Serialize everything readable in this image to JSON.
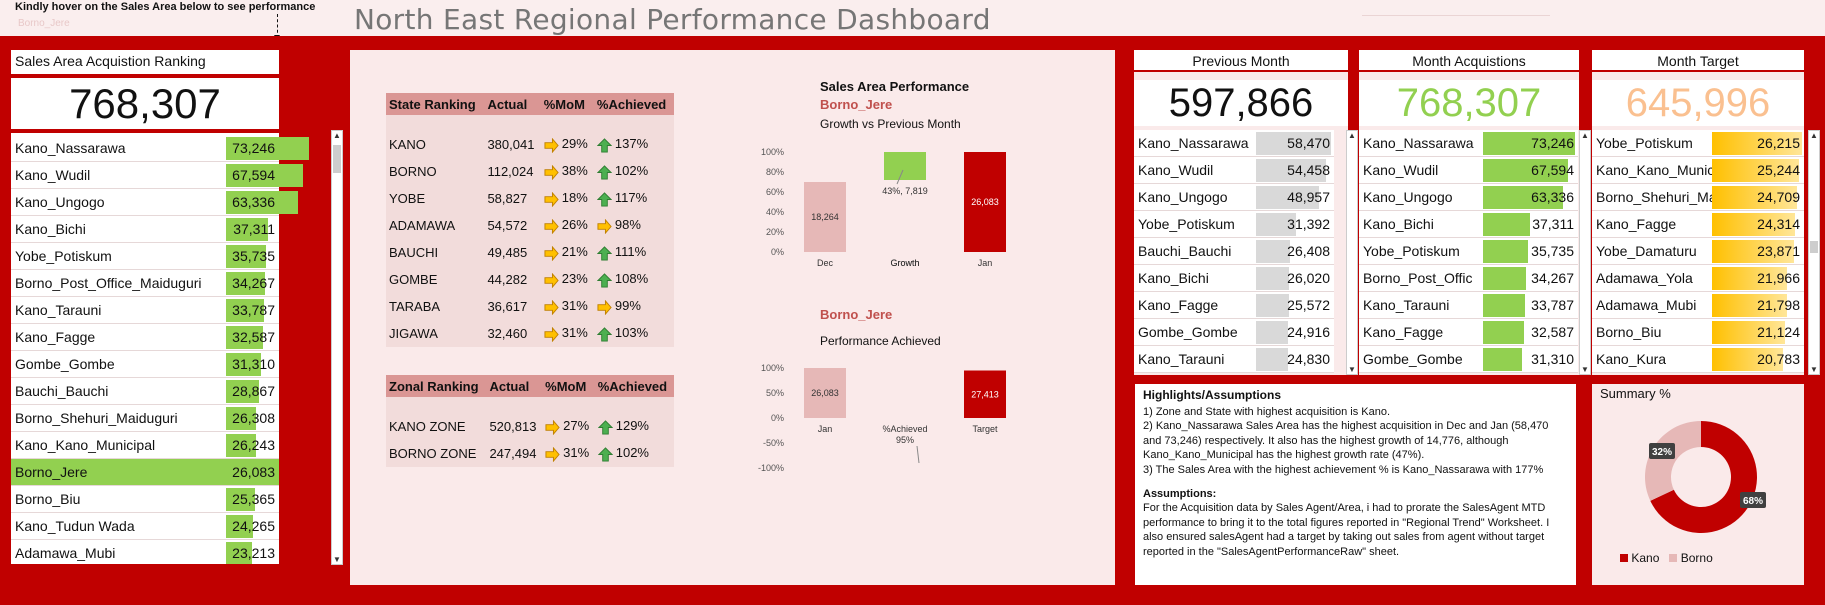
{
  "header": {
    "hint": "Kindly hover on the Sales Area below to see performance",
    "hint_sub": "Borno_Jere",
    "title": "North East Regional Performance Dashboard"
  },
  "ranking": {
    "title": "Sales Area Acquistion Ranking",
    "total": "768,307",
    "max": 73246,
    "items": [
      {
        "name": "Kano_Nassarawa",
        "value": "73,246",
        "n": 73246
      },
      {
        "name": "Kano_Wudil",
        "value": "67,594",
        "n": 67594
      },
      {
        "name": "Kano_Ungogo",
        "value": "63,336",
        "n": 63336
      },
      {
        "name": "Kano_Bichi",
        "value": "37,311",
        "n": 37311
      },
      {
        "name": "Yobe_Potiskum",
        "value": "35,735",
        "n": 35735
      },
      {
        "name": "Borno_Post_Office_Maiduguri",
        "value": "34,267",
        "n": 34267
      },
      {
        "name": "Kano_Tarauni",
        "value": "33,787",
        "n": 33787
      },
      {
        "name": "Kano_Fagge",
        "value": "32,587",
        "n": 32587
      },
      {
        "name": "Gombe_Gombe",
        "value": "31,310",
        "n": 31310
      },
      {
        "name": "Bauchi_Bauchi",
        "value": "28,867",
        "n": 28867
      },
      {
        "name": "Borno_Shehuri_Maiduguri",
        "value": "26,308",
        "n": 26308
      },
      {
        "name": "Kano_Kano_Municipal",
        "value": "26,243",
        "n": 26243
      },
      {
        "name": "Borno_Jere",
        "value": "26,083",
        "n": 26083,
        "selected": true
      },
      {
        "name": "Borno_Biu",
        "value": "25,365",
        "n": 25365
      },
      {
        "name": "Kano_Tudun Wada",
        "value": "24,265",
        "n": 24265
      },
      {
        "name": "Adamawa_Mubi",
        "value": "23,213",
        "n": 23213
      }
    ]
  },
  "state_table": {
    "headers": [
      "State Ranking",
      "Actual",
      "%MoM",
      "%Achieved"
    ],
    "rows": [
      {
        "name": "KANO",
        "actual": "380,041",
        "mom": "29%",
        "ach": "137%",
        "up": true
      },
      {
        "name": "BORNO",
        "actual": "112,024",
        "mom": "38%",
        "ach": "102%",
        "up": true
      },
      {
        "name": "YOBE",
        "actual": "58,827",
        "mom": "18%",
        "ach": "117%",
        "up": true
      },
      {
        "name": "ADAMAWA",
        "actual": "54,572",
        "mom": "26%",
        "ach": "98%",
        "up": false
      },
      {
        "name": "BAUCHI",
        "actual": "49,485",
        "mom": "21%",
        "ach": "111%",
        "up": true
      },
      {
        "name": "GOMBE",
        "actual": "44,282",
        "mom": "23%",
        "ach": "108%",
        "up": true
      },
      {
        "name": "TARABA",
        "actual": "36,617",
        "mom": "31%",
        "ach": "99%",
        "up": false
      },
      {
        "name": "JIGAWA",
        "actual": "32,460",
        "mom": "31%",
        "ach": "103%",
        "up": true
      }
    ]
  },
  "zonal_table": {
    "headers": [
      "Zonal Ranking",
      "Actual",
      "%MoM",
      "%Achieved"
    ],
    "rows": [
      {
        "name": "KANO ZONE",
        "actual": "520,813",
        "mom": "27%",
        "ach": "129%",
        "up": true
      },
      {
        "name": "BORNO ZONE",
        "actual": "247,494",
        "mom": "31%",
        "ach": "102%",
        "up": true
      }
    ]
  },
  "chart_data": [
    {
      "type": "bar",
      "title": "Sales Area Performance",
      "subtitle_area": "Borno_Jere",
      "subtitle": "Growth vs Previous Month",
      "categories": [
        "Dec",
        "Growth",
        "Jan"
      ],
      "values": [
        18264,
        7819,
        26083
      ],
      "labels": [
        "18,264",
        "43%,  7,819",
        "26,083"
      ],
      "ylim": [
        0,
        100
      ],
      "yticks": [
        "100%",
        "80%",
        "60%",
        "40%",
        "20%",
        "0%"
      ],
      "percent": [
        70,
        28,
        100
      ]
    },
    {
      "type": "bar",
      "title": "Borno_Jere",
      "subtitle": "Performance Achieved",
      "categories": [
        "Jan",
        "%Achieved",
        "Target"
      ],
      "values": [
        26083,
        95,
        27413
      ],
      "labels": [
        "26,083",
        "%Achieved\n95%",
        "27,413"
      ],
      "ylim": [
        -100,
        100
      ],
      "yticks": [
        "100%",
        "50%",
        "0%",
        "-50%",
        "-100%"
      ],
      "percent": [
        100,
        0,
        95
      ]
    }
  ],
  "prev": {
    "title": "Previous Month",
    "total": "597,866",
    "max": 58470,
    "items": [
      {
        "name": "Kano_Nassarawa",
        "value": "58,470",
        "n": 58470
      },
      {
        "name": "Kano_Wudil",
        "value": "54,458",
        "n": 54458
      },
      {
        "name": "Kano_Ungogo",
        "value": "48,957",
        "n": 48957
      },
      {
        "name": "Yobe_Potiskum",
        "value": "31,392",
        "n": 31392
      },
      {
        "name": "Bauchi_Bauchi",
        "value": "26,408",
        "n": 26408
      },
      {
        "name": "Kano_Bichi",
        "value": "26,020",
        "n": 26020
      },
      {
        "name": "Kano_Fagge",
        "value": "25,572",
        "n": 25572
      },
      {
        "name": "Gombe_Gombe",
        "value": "24,916",
        "n": 24916
      },
      {
        "name": "Kano_Tarauni",
        "value": "24,830",
        "n": 24830
      }
    ]
  },
  "acq": {
    "title": "Month Acquistions",
    "total": "768,307",
    "max": 73246,
    "items": [
      {
        "name": "Kano_Nassarawa",
        "value": "73,246",
        "n": 73246
      },
      {
        "name": "Kano_Wudil",
        "value": "67,594",
        "n": 67594
      },
      {
        "name": "Kano_Ungogo",
        "value": "63,336",
        "n": 63336
      },
      {
        "name": "Kano_Bichi",
        "value": "37,311",
        "n": 37311
      },
      {
        "name": "Yobe_Potiskum",
        "value": "35,735",
        "n": 35735
      },
      {
        "name": "Borno_Post_Offic",
        "value": "34,267",
        "n": 34267
      },
      {
        "name": "Kano_Tarauni",
        "value": "33,787",
        "n": 33787
      },
      {
        "name": "Kano_Fagge",
        "value": "32,587",
        "n": 32587
      },
      {
        "name": "Gombe_Gombe",
        "value": "31,310",
        "n": 31310
      }
    ]
  },
  "target": {
    "title": "Month Target",
    "total": "645,996",
    "max": 26215,
    "items": [
      {
        "name": "Yobe_Potiskum",
        "value": "26,215",
        "n": 26215
      },
      {
        "name": "Kano_Kano_Munic",
        "value": "25,244",
        "n": 25244
      },
      {
        "name": "Borno_Shehuri_Ma",
        "value": "24,709",
        "n": 24709
      },
      {
        "name": "Kano_Fagge",
        "value": "24,314",
        "n": 24314
      },
      {
        "name": "Yobe_Damaturu",
        "value": "23,871",
        "n": 23871
      },
      {
        "name": "Adamawa_Yola",
        "value": "21,966",
        "n": 21966
      },
      {
        "name": "Adamawa_Mubi",
        "value": "21,798",
        "n": 21798
      },
      {
        "name": "Borno_Biu",
        "value": "21,124",
        "n": 21124
      },
      {
        "name": "Kano_Kura",
        "value": "20,783",
        "n": 20783
      }
    ]
  },
  "highlights": {
    "title": "Highlights/Assumptions",
    "p1": "1) Zone and State with highest acquisition is Kano.",
    "p2": "2) Kano_Nassarawa Sales Area has the highest acquisition in Dec and Jan (58,470 and 73,246) respectively. It also has the highest growth of 14,776, although Kano_Kano_Municipal has the highest growth rate (47%).",
    "p3": "3) The Sales Area with the highest achievement % is Kano_Nassarawa with 177%",
    "assump_title": "Assumptions:",
    "assump": "For the Acquisition data by Sales Agent/Area, i had to prorate the SalesAgent MTD performance to bring it to the total figures reported in \"Regional Trend\" Worksheet. I also ensured salesAgent had a target by taking out sales from agent without target reported in the \"SalesAgentPerformanceRaw\" sheet."
  },
  "summary": {
    "title": "Summary %",
    "kano_label": "68%",
    "borno_label": "32%",
    "legend_kano": "Kano",
    "legend_borno": "Borno",
    "kano_pct": 68
  },
  "colors": {
    "red": "#c00000",
    "green": "#92d050",
    "orange": "#ffc000",
    "grey": "#d9d9d9",
    "pink": "#e6b8b7",
    "achieved": "#f2aa84"
  }
}
